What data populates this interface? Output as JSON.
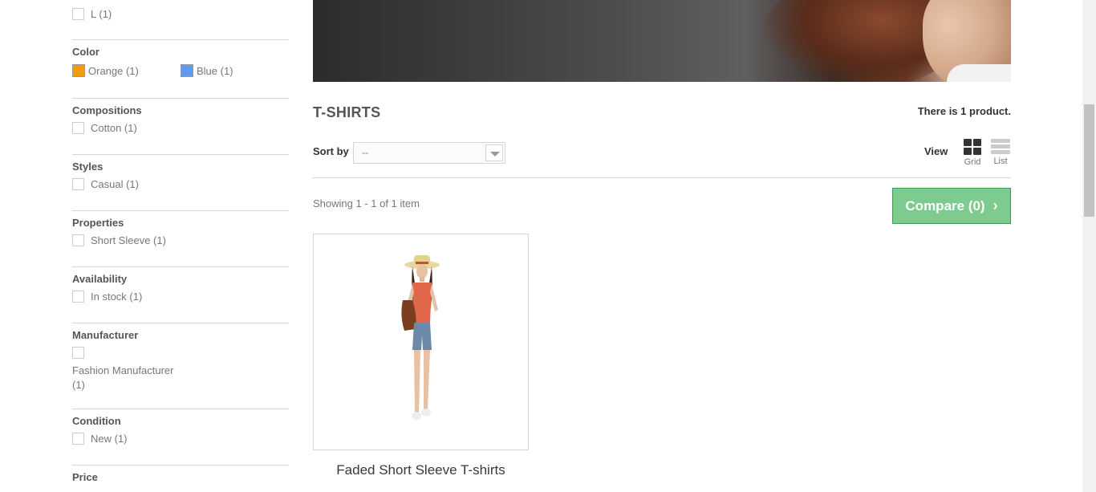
{
  "sidebar": {
    "size_option": "L (1)",
    "color": {
      "title": "Color",
      "options": [
        {
          "label": "Orange (1)",
          "hex": "#f39c11"
        },
        {
          "label": "Blue (1)",
          "hex": "#5d9cec"
        }
      ]
    },
    "compositions": {
      "title": "Compositions",
      "option": "Cotton (1)"
    },
    "styles": {
      "title": "Styles",
      "option": "Casual (1)"
    },
    "properties": {
      "title": "Properties",
      "option": "Short Sleeve (1)"
    },
    "availability": {
      "title": "Availability",
      "option": "In stock (1)"
    },
    "manufacturer": {
      "title": "Manufacturer",
      "option_line1": "Fashion Manufacturer",
      "option_line2": "(1)"
    },
    "condition": {
      "title": "Condition",
      "option": "New (1)"
    },
    "price": {
      "title": "Price"
    }
  },
  "main": {
    "category_title": "T-SHIRTS",
    "product_count_prefix": "There is ",
    "product_count_number": "1",
    "product_count_suffix": " product.",
    "sort_label": "Sort by",
    "sort_value": "--",
    "view_label": "View",
    "view_grid": "Grid",
    "view_list": "List",
    "showing": "Showing 1 - 1 of 1 item",
    "compare_label": "Compare (0)",
    "compare_color": "#7ecb8f",
    "product": {
      "name": "Faded Short Sleeve T-shirts"
    }
  }
}
